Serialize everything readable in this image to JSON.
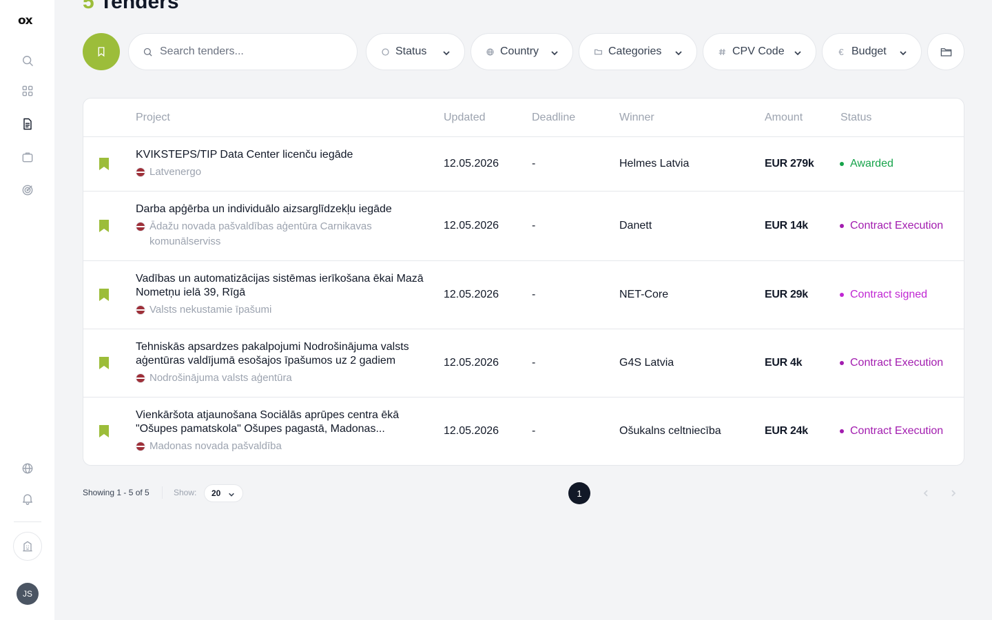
{
  "app": {
    "logo": "ox",
    "user_initials": "JS"
  },
  "page": {
    "count": "5",
    "title": "Tenders"
  },
  "toolbar": {
    "search_placeholder": "Search tenders...",
    "filters": {
      "status": "Status",
      "country": "Country",
      "categories": "Categories",
      "cpv": "CPV Code",
      "budget": "Budget"
    }
  },
  "table": {
    "headers": {
      "project": "Project",
      "updated": "Updated",
      "deadline": "Deadline",
      "winner": "Winner",
      "amount": "Amount",
      "status": "Status"
    },
    "rows": [
      {
        "title": "KVIKSTEPS/TIP Data Center licenču iegāde",
        "buyer": "Latvenergo",
        "updated": "12.05.2026",
        "deadline": "-",
        "winner": "Helmes Latvia",
        "amount": "EUR 279k",
        "status": "Awarded",
        "status_color": "#16a34a"
      },
      {
        "title": "Darba apģērba un individuālo aizsarglīdzekļu iegāde",
        "buyer": "Ādažu novada pašvaldības aģentūra Carnikavas komunālserviss",
        "updated": "12.05.2026",
        "deadline": "-",
        "winner": "Danett",
        "amount": "EUR 14k",
        "status": "Contract Execution",
        "status_color": "#a21caf"
      },
      {
        "title": "Vadības un automatizācijas sistēmas ierīkošana ēkai Mazā Nometņu ielā 39, Rīgā",
        "buyer": "Valsts nekustamie īpašumi",
        "updated": "12.05.2026",
        "deadline": "-",
        "winner": "NET-Core",
        "amount": "EUR 29k",
        "status": "Contract signed",
        "status_color": "#c026d3"
      },
      {
        "title": "Tehniskās apsardzes pakalpojumi Nodrošinājuma valsts aģentūras valdījumā esošajos īpašumos uz 2 gadiem",
        "buyer": "Nodrošinājuma valsts aģentūra",
        "updated": "12.05.2026",
        "deadline": "-",
        "winner": "G4S Latvia",
        "amount": "EUR 4k",
        "status": "Contract Execution",
        "status_color": "#a21caf"
      },
      {
        "title": "Vienkāršota atjaunošana Sociālās aprūpes centra ēkā \"Ošupes pamatskola\" Ošupes pagastā, Madonas...",
        "buyer": "Madonas novada pašvaldība",
        "updated": "12.05.2026",
        "deadline": "-",
        "winner": "Ošukalns celtniecība",
        "amount": "EUR 24k",
        "status": "Contract Execution",
        "status_color": "#a21caf"
      }
    ]
  },
  "footer": {
    "showing": "Showing 1 - 5 of 5",
    "show_label": "Show:",
    "page_size": "20",
    "current_page": "1"
  },
  "colors": {
    "accent": "#9cbd3a",
    "awarded": "#16a34a",
    "execution": "#a21caf"
  }
}
